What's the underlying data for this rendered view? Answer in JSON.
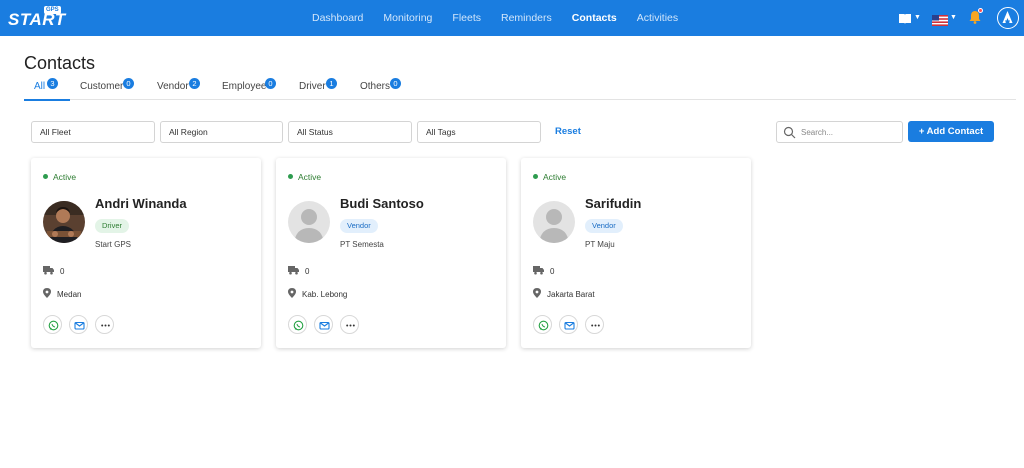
{
  "app": {
    "logo_text": "START",
    "logo_badge": "GPS"
  },
  "nav": [
    {
      "label": "Dashboard",
      "active": false
    },
    {
      "label": "Monitoring",
      "active": false
    },
    {
      "label": "Fleets",
      "active": false
    },
    {
      "label": "Reminders",
      "active": false
    },
    {
      "label": "Contacts",
      "active": true
    },
    {
      "label": "Activities",
      "active": false
    }
  ],
  "header_icons": {
    "book": "book-icon",
    "flag": "us-flag-icon",
    "bell": "bell-icon",
    "avatar": "user-avatar-icon"
  },
  "page": {
    "title": "Contacts"
  },
  "tabs": [
    {
      "label": "All",
      "count": "3",
      "active": true
    },
    {
      "label": "Customer",
      "count": "0",
      "active": false
    },
    {
      "label": "Vendor",
      "count": "2",
      "active": false
    },
    {
      "label": "Employee",
      "count": "0",
      "active": false
    },
    {
      "label": "Driver",
      "count": "1",
      "active": false
    },
    {
      "label": "Others",
      "count": "0",
      "active": false
    }
  ],
  "filters": {
    "fleet": "All Fleet",
    "region": "All Region",
    "status": "All Status",
    "tags": "All Tags",
    "reset_label": "Reset",
    "search_placeholder": "Search...",
    "add_contact_label": "+ Add Contact"
  },
  "contacts": [
    {
      "status": "Active",
      "name": "Andri Winanda",
      "role": "Driver",
      "company": "Start GPS",
      "vehicles": "0",
      "location": "Medan"
    },
    {
      "status": "Active",
      "name": "Budi Santoso",
      "role": "Vendor",
      "company": "PT Semesta",
      "vehicles": "0",
      "location": "Kab. Lebong"
    },
    {
      "status": "Active",
      "name": "Sarifudin",
      "role": "Vendor",
      "company": "PT Maju",
      "vehicles": "0",
      "location": "Jakarta Barat"
    }
  ],
  "colors": {
    "primary": "#1a7de0",
    "active_status": "#2e9c4f",
    "whatsapp": "#25a244"
  }
}
